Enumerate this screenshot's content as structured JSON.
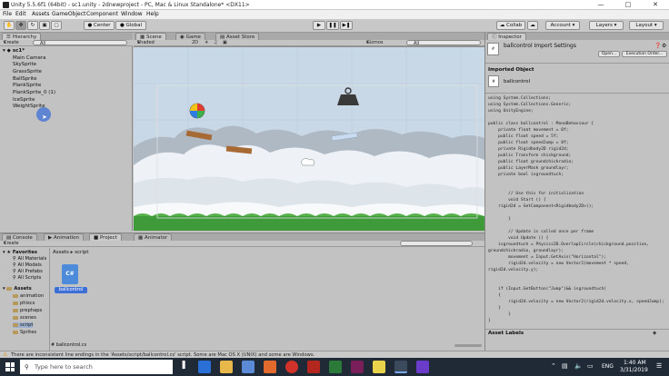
{
  "window": {
    "title": "Unity 5.5.6f1 (64bit) - sc1.unity - 2dnewproject - PC, Mac & Linux Standalone* <DX11>"
  },
  "menu": [
    "File",
    "Edit",
    "Assets",
    "GameObject",
    "Component",
    "Window",
    "Help"
  ],
  "toolbar": {
    "pivot_label": "Center",
    "space_label": "Global",
    "collab_label": "Collab",
    "account_label": "Account",
    "layers_label": "Layers",
    "layout_label": "Layout"
  },
  "hierarchy": {
    "tab": "Hierarchy",
    "create_label": "Create",
    "search_placeholder": "All",
    "scene_name": "sc1*",
    "items": [
      "Main Camera",
      "SkySprite",
      "GrassSprite",
      "BallSprite",
      "PlankSprite",
      "PlankSprite_0 (1)",
      "IceSprite",
      "WeightSprite"
    ]
  },
  "scene": {
    "tabs": [
      "Scene",
      "Game",
      "Asset Store"
    ],
    "shaded_label": "Shaded",
    "mode_label": "2D",
    "gizmos_label": "Gizmos",
    "search_placeholder": "All"
  },
  "inspector": {
    "tab": "Inspector",
    "asset_title": "ballcontrol Import Settings",
    "open_label": "Open...",
    "exec_order_label": "Execution Order...",
    "imported_object_label": "Imported Object",
    "object_name": "ballcontrol",
    "asset_labels": "Asset Labels",
    "code": [
      "using System.Collections;",
      "using System.Collections.Generic;",
      "using UnityEngine;",
      "",
      "public class ballcontrol : MonoBehaviour {",
      "    private float movement = 0f;",
      "    public float speed = 5f;",
      "    public float speedJump = 8f;",
      "    private Rigidbody2D rigid2d;",
      "    public Transform chickground;",
      "    public float groundchickradio;",
      "    public LayerMask groundlayr;",
      "    private bool isgroundtuch;",
      "",
      "",
      "        // Use this for initialization",
      "        void Start () {",
      "    rigid2d = GetComponent<Rigidbody2D>();",
      "",
      "        }",
      "",
      "        // Update is called once per frame",
      "        void Update () {",
      "    isgroundtuch = Physics2D.OverlapCircle(chickground.position,",
      "groundchickradio, groundlayr);",
      "        movement = Input.GetAxis(\"Horizontal\");",
      "        rigid2d.velocity = new Vector2(movement * speed,",
      "rigid2d.velocity.y);",
      "",
      "",
      "    if (Input.GetButton(\"Jump\")&& isgroundtuch)",
      "    {",
      "        rigid2d.velocity = new Vector2(rigid2d.velocity.x, speedJump);",
      "    }",
      "        }",
      "}"
    ]
  },
  "bottom": {
    "tabs": [
      "Console",
      "Animation",
      "Project"
    ],
    "animator_tab": "Animator",
    "create_label": "Create",
    "breadcrumb": [
      "Assets",
      "script"
    ],
    "favorites_label": "Favorites",
    "favorites": [
      "All Materials",
      "All Models",
      "All Prefabs",
      "All Scripts"
    ],
    "assets_label": "Assets",
    "folders": [
      "animation",
      "phiscs",
      "prephaps",
      "scenes",
      "script",
      "Sprites"
    ],
    "file_name": "ballcontrol",
    "file_glyph": "C#",
    "selected_path": "ballcontrol.cs"
  },
  "status": {
    "message": "There are inconsistent line endings in the 'Assets/script/ballcontrol.cs' script. Some are Mac OS X (UNIX) and some are Windows."
  },
  "taskbar": {
    "search_placeholder": "Type here to search",
    "lang": "ENG",
    "time": "1:40 AM",
    "date": "3/31/2019"
  },
  "colors": {
    "sky": "#c9d8e6",
    "grass": "#3f9a3a",
    "selection": "#3d6fd6"
  }
}
